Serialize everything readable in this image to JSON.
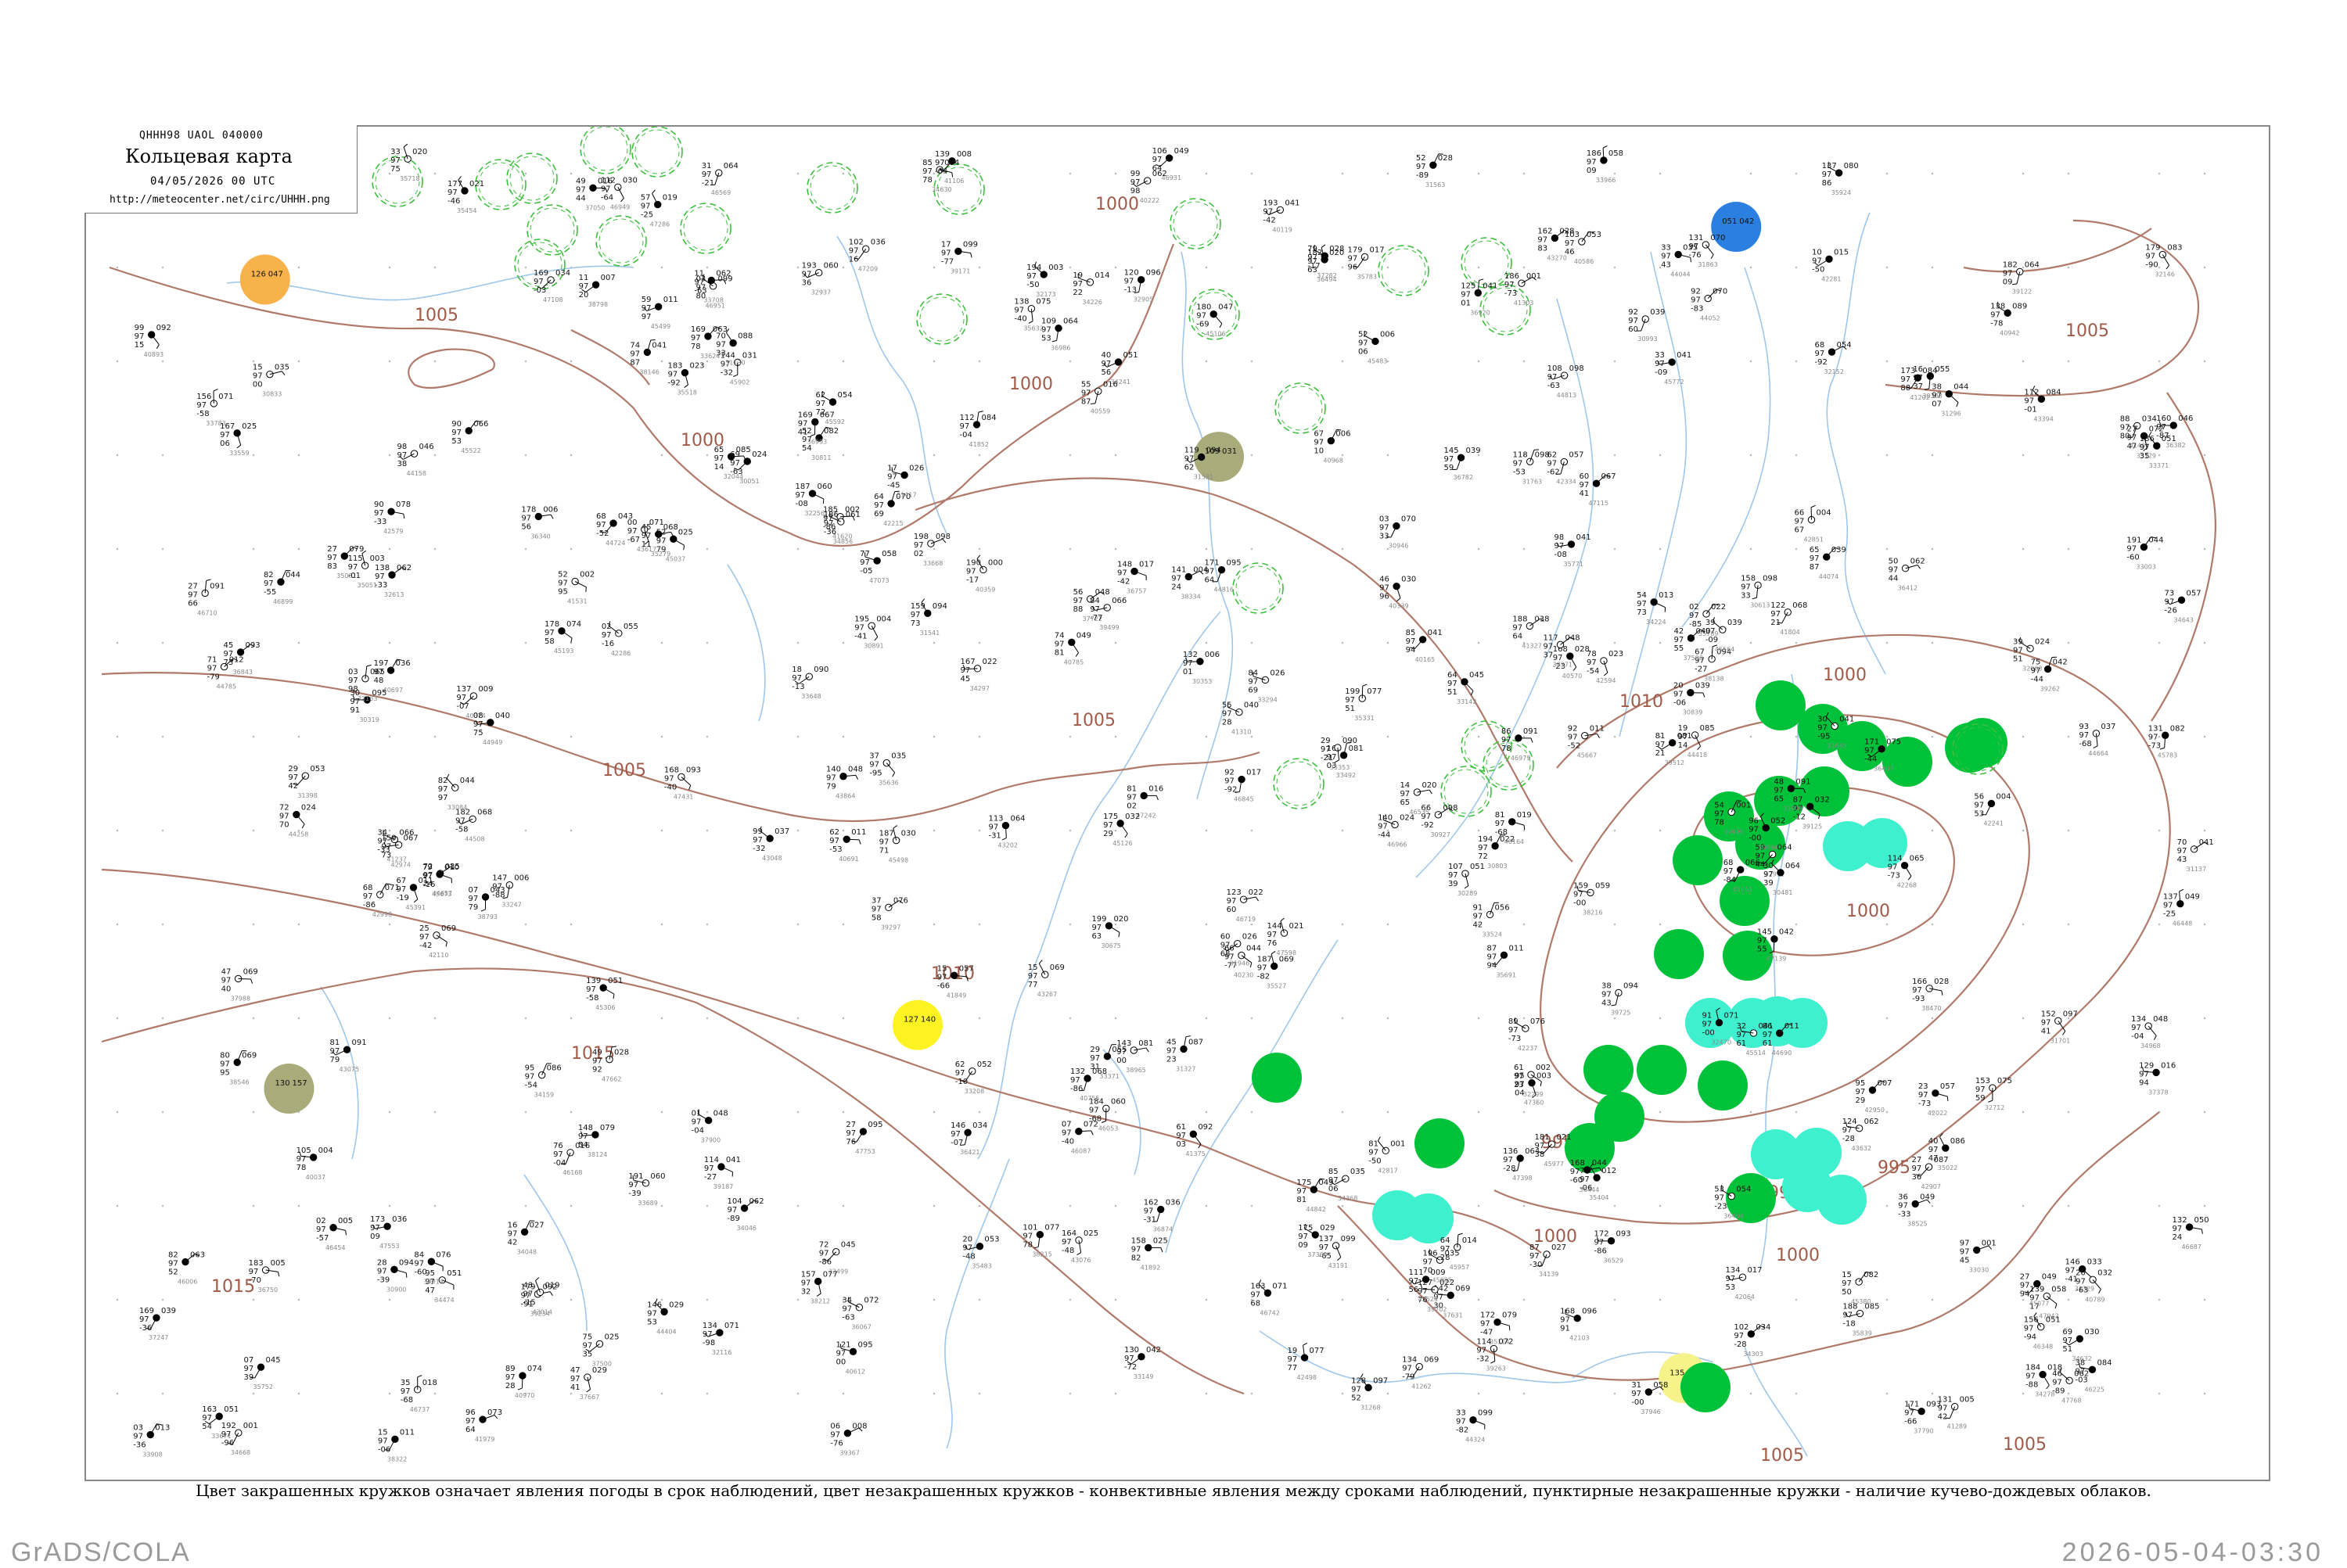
{
  "header": {
    "code": "QHHH98  UAOL  040000",
    "title": "Кольцевая карта",
    "time": "04/05/2026 00 UTC",
    "url": "http://meteocenter.net/circ/UHHH.png"
  },
  "caption": "Цвет закрашенных кружков означает явления погоды в срок наблюдений, цвет незакрашенных кружков - конвективные явления между сроками наблюдений, пунктирные незакрашенные кружки - наличие кучево-дождевых облаков.",
  "footer": {
    "left": "GrADS/COLA",
    "right": "2026-05-04-03:30"
  },
  "colors": {
    "isobar": "#b07a6a",
    "river": "#9fc7ea",
    "rain": "#00c23a",
    "shower": "#3ff0cf",
    "haze_orange": "#f7b24a",
    "dust_olive": "#a9ab7a",
    "fog_yellow": "#fdf323",
    "pale_yellow": "#f6f38a",
    "blue": "#2a7fe0",
    "cb_dashed": "#3fbf3f"
  },
  "isobar_labels": [
    "1005",
    "1000",
    "1000",
    "1000",
    "1010",
    "1015",
    "1005",
    "1005",
    "1000",
    "995",
    "995",
    "1000",
    "1000",
    "1005",
    "1005",
    "1005",
    "1000",
    "995",
    "1015",
    "1010",
    "1000"
  ],
  "stations": [
    {
      "id": "s1",
      "t": "126",
      "p": "047",
      "color": "haze_orange",
      "filled": true,
      "lx": 0.082,
      "ly": 0.113
    },
    {
      "id": "s2",
      "t": "109",
      "p": "031",
      "color": "dust_olive",
      "filled": true,
      "lx": 0.519,
      "ly": 0.244
    },
    {
      "id": "s3",
      "t": "130",
      "p": "157",
      "color": "dust_olive",
      "filled": true,
      "lx": 0.093,
      "ly": 0.711
    },
    {
      "id": "s4",
      "t": "127",
      "p": "140",
      "color": "fog_yellow",
      "filled": true,
      "lx": 0.381,
      "ly": 0.664
    },
    {
      "id": "s5",
      "t": "135",
      "p": "019",
      "color": "pale_yellow",
      "filled": true,
      "lx": 0.732,
      "ly": 0.925
    },
    {
      "id": "s6",
      "t": "051",
      "p": "042",
      "color": "blue",
      "filled": true,
      "lx": 0.756,
      "ly": 0.074
    }
  ]
}
